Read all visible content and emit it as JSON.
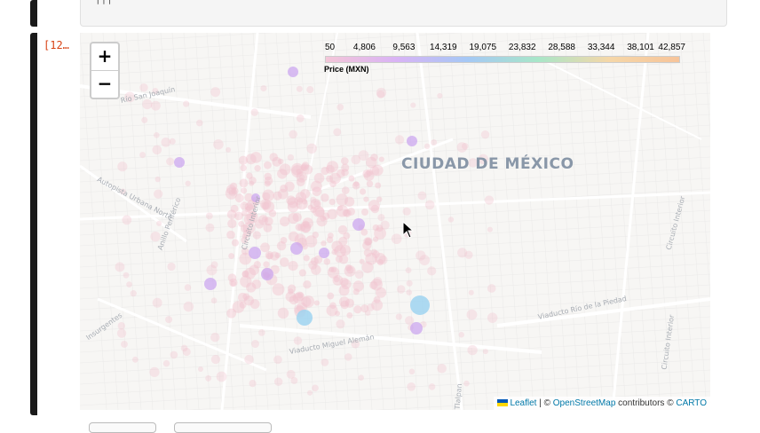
{
  "notebook": {
    "prev_output_text": "|||",
    "cell_prompt": "[12…"
  },
  "map": {
    "zoom_in_label": "+",
    "zoom_out_label": "−",
    "legend": {
      "ticks": [
        "50",
        "4,806",
        "9,563",
        "14,319",
        "19,075",
        "23,832",
        "28,588",
        "33,344",
        "38,101",
        "42,857"
      ],
      "caption": "Price (MXN)",
      "gradient_colors": [
        "#f4c6d8",
        "#d9b3f5",
        "#a5c8f5",
        "#a8e6c8",
        "#f5d7a8",
        "#f7c49a"
      ]
    },
    "city_label": "CIUDAD DE MÉXICO",
    "street_labels": [
      "Río San Joaquín",
      "Autopista Urbana Norte",
      "Anillo Periférico",
      "Circuito Interior",
      "Viaducto Miguel Alemán",
      "Viaducto Río de la Piedad",
      "Insurgentes",
      "Circuito Interior",
      "Tlalpan",
      "Circuito Interior"
    ],
    "attribution": {
      "leaflet": "Leaflet",
      "sep": "| ©",
      "osm": "OpenStreetMap",
      "mid": "contributors ©",
      "carto": "CARTO"
    },
    "marker_colors": {
      "low": "#f2c4cf",
      "mid": "#c9a3ef",
      "high": "#9fd3f0"
    }
  }
}
